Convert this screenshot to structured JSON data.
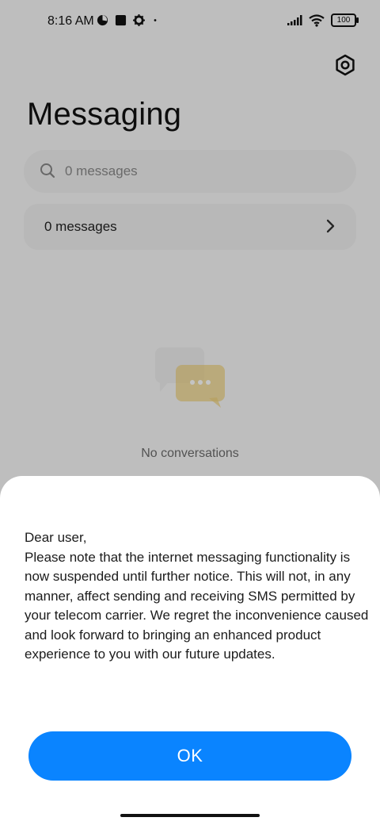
{
  "status_bar": {
    "time": "8:16 AM",
    "battery_level": "100",
    "icons": [
      "data-saver-icon",
      "stop-icon",
      "settings-icon",
      "dot-icon",
      "signal-icon",
      "wifi-icon",
      "battery-icon"
    ]
  },
  "header": {
    "title": "Messaging",
    "settings_icon": "settings-hex-icon"
  },
  "search": {
    "placeholder": "0 messages"
  },
  "messages_row": {
    "label": "0 messages"
  },
  "empty_state": {
    "text": "No conversations"
  },
  "dialog": {
    "message": "Dear user,\nPlease note that the internet messaging functionality is now suspended until further notice. This will not, in any manner, affect sending and receiving SMS permitted by your telecom carrier. We regret the inconvenience caused and look forward to bringing an enhanced product experience to you with our future updates.",
    "ok_label": "OK"
  },
  "colors": {
    "accent": "#0A84FF",
    "background": "#F7F7F7",
    "sheet": "#FFFFFF"
  }
}
